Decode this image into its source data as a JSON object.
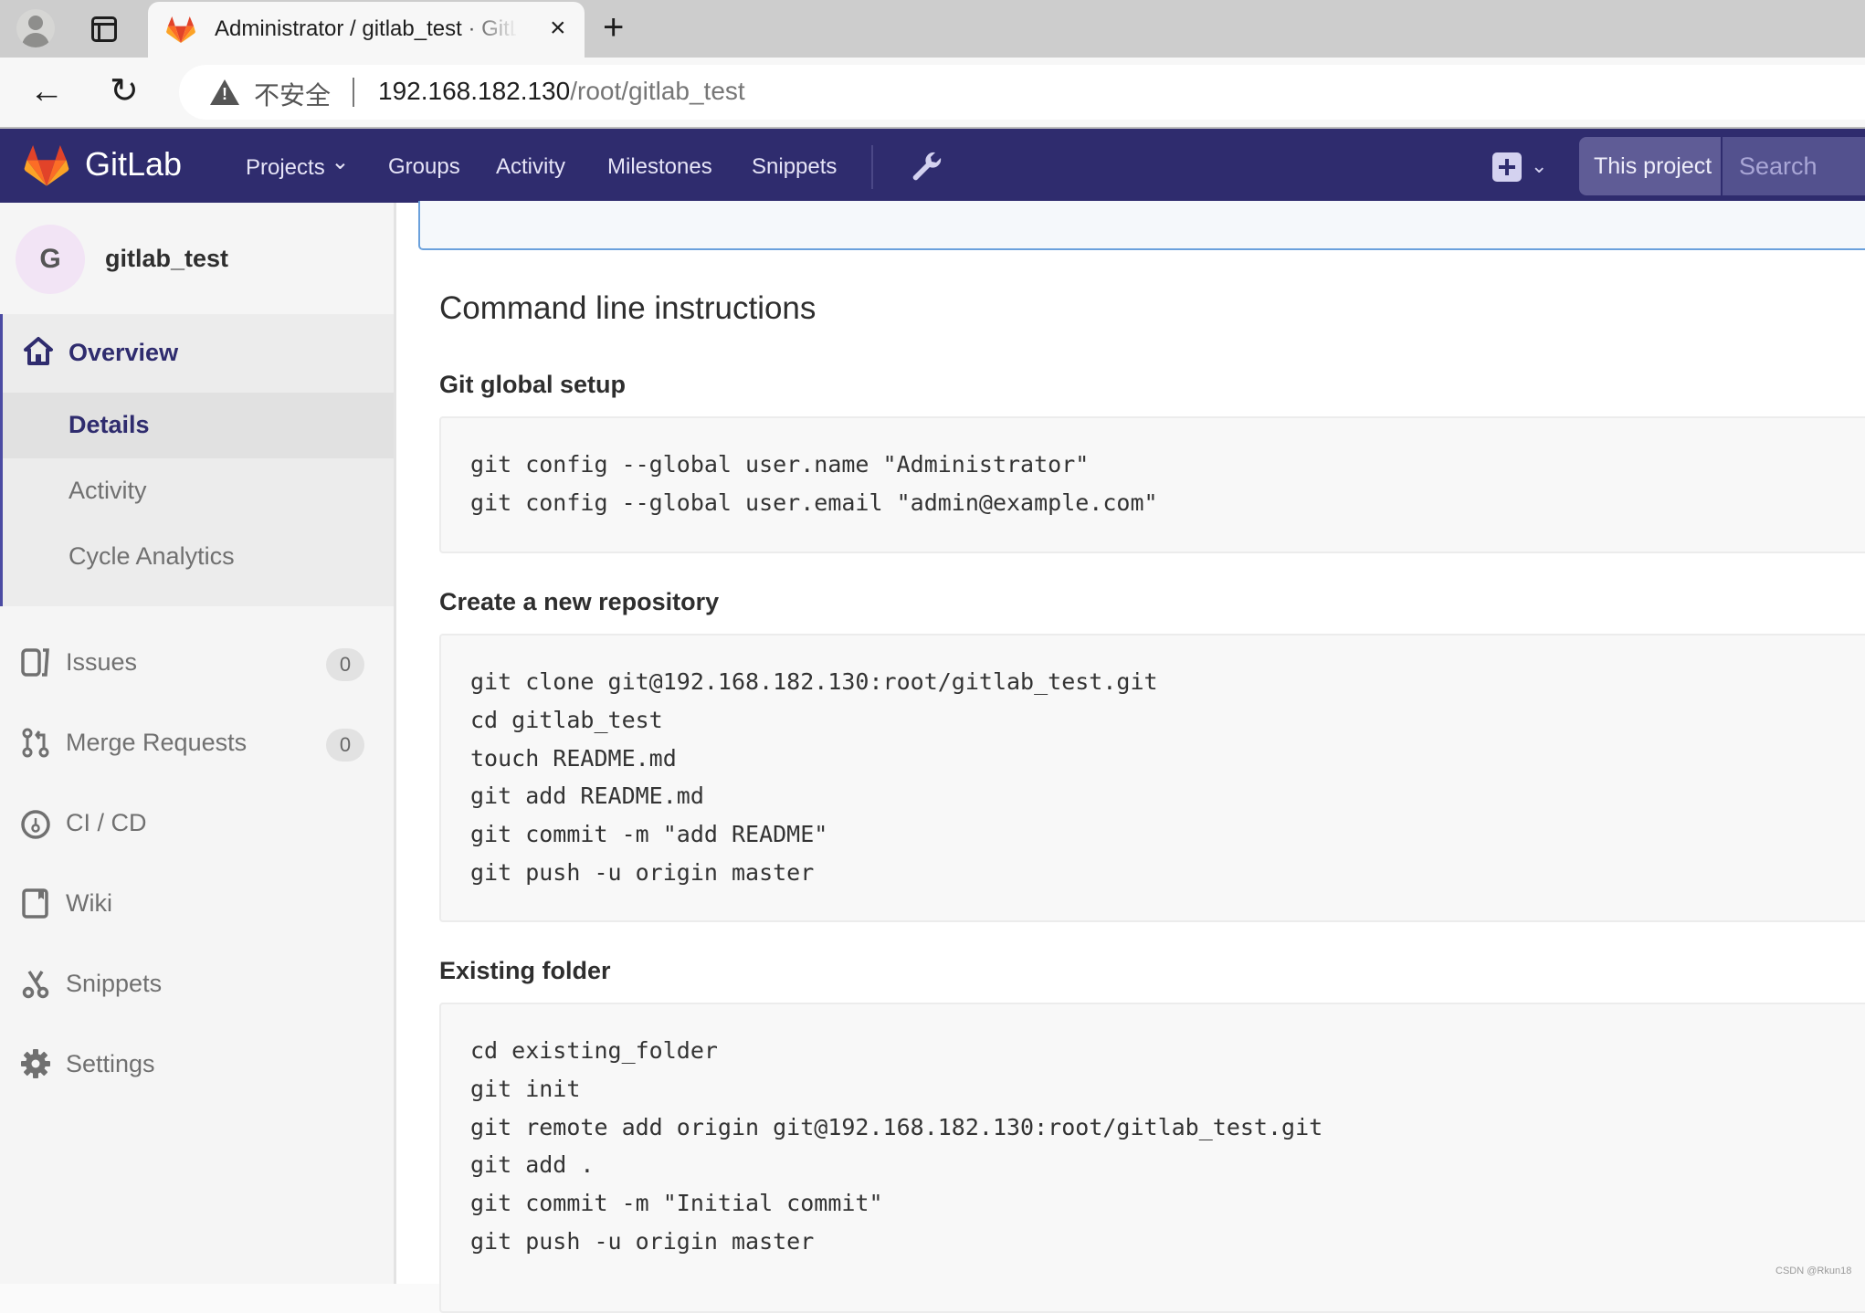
{
  "browser": {
    "tab_title": "Administrator / gitlab_test · GitLab",
    "close_glyph": "×",
    "new_tab_glyph": "+",
    "back_glyph": "←",
    "reload_glyph": "↻",
    "security_label": "不安全",
    "url_host": "192.168.182.130",
    "url_path": "/root/gitlab_test"
  },
  "navbar": {
    "brand": "GitLab",
    "links": [
      "Projects",
      "Groups",
      "Activity",
      "Milestones",
      "Snippets"
    ],
    "projects_chevron": "⌄",
    "plus_chevron": "⌄",
    "search_scope": "This project",
    "search_placeholder": "Search",
    "colors": {
      "navbar_bg": "#2f2c6e",
      "accent": "#4b4ba3"
    }
  },
  "sidebar": {
    "project_initial": "G",
    "project_name": "gitlab_test",
    "overview": {
      "label": "Overview",
      "children": [
        "Details",
        "Activity",
        "Cycle Analytics"
      ],
      "active_child": "Details"
    },
    "items": [
      {
        "label": "Issues",
        "icon": "issues-icon",
        "count": "0"
      },
      {
        "label": "Merge Requests",
        "icon": "merge-request-icon",
        "count": "0"
      },
      {
        "label": "CI / CD",
        "icon": "pipeline-icon"
      },
      {
        "label": "Wiki",
        "icon": "book-icon"
      },
      {
        "label": "Snippets",
        "icon": "scissors-icon"
      },
      {
        "label": "Settings",
        "icon": "gear-icon"
      }
    ]
  },
  "main": {
    "heading": "Command line instructions",
    "sections": [
      {
        "title": "Git global setup",
        "lines": [
          "git config --global user.name \"Administrator\"",
          "git config --global user.email \"admin@example.com\""
        ]
      },
      {
        "title": "Create a new repository",
        "lines": [
          "git clone git@192.168.182.130:root/gitlab_test.git",
          "cd gitlab_test",
          "touch README.md",
          "git add README.md",
          "git commit -m \"add README\"",
          "git push -u origin master"
        ]
      },
      {
        "title": "Existing folder",
        "lines": [
          "cd existing_folder",
          "git init",
          "git remote add origin git@192.168.182.130:root/gitlab_test.git",
          "git add .",
          "git commit -m \"Initial commit\"",
          "git push -u origin master"
        ]
      }
    ]
  },
  "watermark": "CSDN @Rkun18"
}
